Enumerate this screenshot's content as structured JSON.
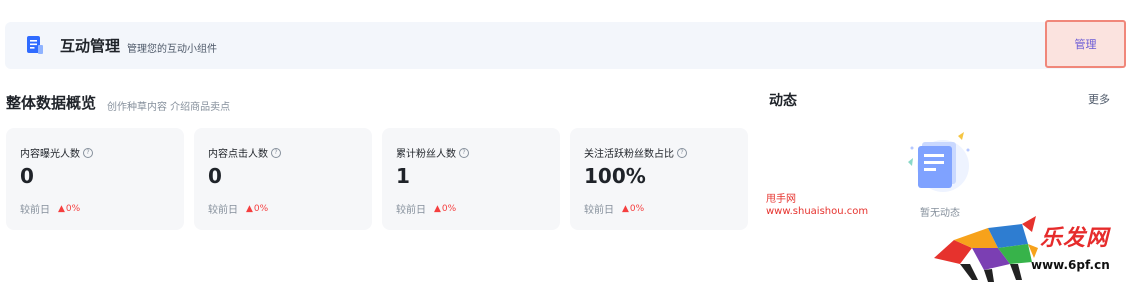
{
  "header": {
    "title": "互动管理",
    "subtitle": "管理您的互动小组件",
    "manage_label": "管理",
    "icon": "document-icon"
  },
  "overview": {
    "title": "整体数据概览",
    "subtitle": "创作种草内容 介绍商品卖点",
    "cards": [
      {
        "label": "内容曝光人数",
        "value": "0",
        "compare_label": "较前日",
        "delta": "0%"
      },
      {
        "label": "内容点击人数",
        "value": "0",
        "compare_label": "较前日",
        "delta": "0%"
      },
      {
        "label": "累计粉丝人数",
        "value": "1",
        "compare_label": "较前日",
        "delta": "0%"
      },
      {
        "label": "关注活跃粉丝数占比",
        "value": "100%",
        "compare_label": "较前日",
        "delta": "0%"
      }
    ]
  },
  "activity": {
    "title": "动态",
    "more_label": "更多",
    "empty_text": "暂无动态"
  },
  "watermark": {
    "line1": "甩手网",
    "line2": "www.shuaishou.com",
    "logo_text": "乐发网",
    "logo_url": "www.6pf.cn"
  },
  "colors": {
    "accent": "#6b5bd6",
    "highlight_border": "#f0877a",
    "increase": "#f53f3f",
    "card_bg": "#f6f7f9",
    "banner_bg": "#f3f6fb"
  }
}
